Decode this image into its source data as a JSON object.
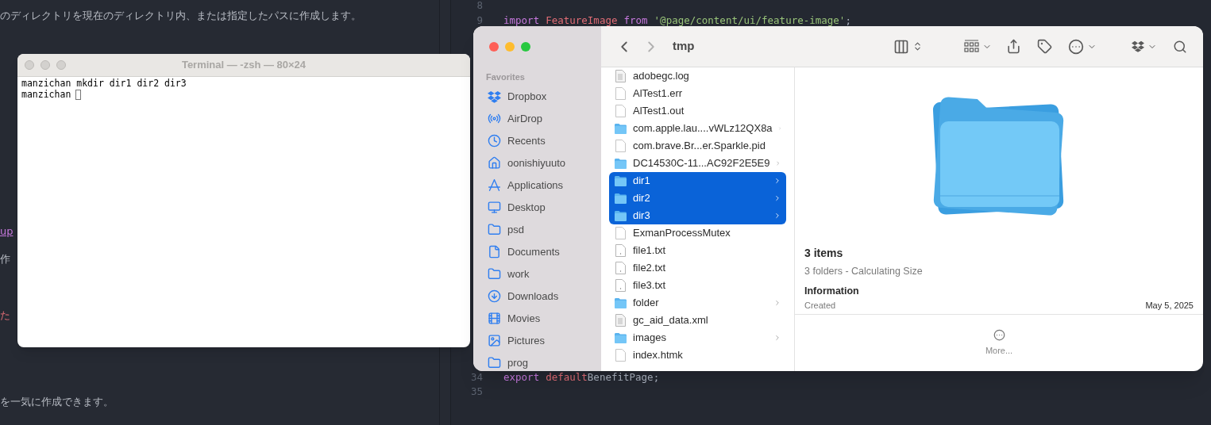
{
  "editor_left": {
    "lines": [
      {
        "text": "のディレクトリを現在のディレクトリ内、または指定したパスに作成します。",
        "kind": "text"
      },
      {
        "text": "up",
        "kind": "link"
      },
      {
        "text": "作",
        "kind": "text"
      },
      {
        "text": "た",
        "kind": "error"
      },
      {
        "text": "を一気に作成できます。",
        "kind": "text"
      }
    ]
  },
  "editor_right": {
    "lines": [
      {
        "number": "8"
      },
      {
        "number": "9",
        "tokens": [
          {
            "text": "import",
            "kind": "keyword"
          },
          {
            "text": "FeatureImage",
            "kind": "name"
          },
          {
            "text": "from",
            "kind": "keyword"
          },
          {
            "text": "'@page/content/ui/feature-image'",
            "kind": "string"
          },
          {
            "text": ";",
            "kind": "plain"
          }
        ]
      },
      {
        "number": "34",
        "tokens": [
          {
            "text": "export",
            "kind": "keyword"
          },
          {
            "text": "default",
            "kind": "name"
          },
          {
            "text": "BenefitPage;",
            "kind": "plain"
          }
        ]
      },
      {
        "number": "35"
      }
    ]
  },
  "terminal": {
    "title": "Terminal — -zsh — 80×24",
    "lines": [
      "manzichan mkdir dir1 dir2 dir3",
      "manzichan"
    ]
  },
  "finder": {
    "title": "tmp",
    "sidebar": {
      "heading": "Favorites",
      "items": [
        {
          "label": "Dropbox"
        },
        {
          "label": "AirDrop"
        },
        {
          "label": "Recents"
        },
        {
          "label": "oonishiyuuto"
        },
        {
          "label": "Applications"
        },
        {
          "label": "Desktop"
        },
        {
          "label": "psd"
        },
        {
          "label": "Documents"
        },
        {
          "label": "work"
        },
        {
          "label": "Downloads"
        },
        {
          "label": "Movies"
        },
        {
          "label": "Pictures"
        },
        {
          "label": "prog"
        }
      ]
    },
    "files": [
      {
        "name": "adobegc.log",
        "kind": "log",
        "selected": false
      },
      {
        "name": "AlTest1.err",
        "kind": "file",
        "selected": false
      },
      {
        "name": "AlTest1.out",
        "kind": "file",
        "selected": false
      },
      {
        "name": "com.apple.lau....vWLz12QX8a",
        "kind": "folder",
        "selected": false
      },
      {
        "name": "com.brave.Br...er.Sparkle.pid",
        "kind": "file",
        "selected": false
      },
      {
        "name": "DC14530C-11...AC92F2E5E9",
        "kind": "folder",
        "selected": false
      },
      {
        "name": "dir1",
        "kind": "folder",
        "selected": true
      },
      {
        "name": "dir2",
        "kind": "folder",
        "selected": true
      },
      {
        "name": "dir3",
        "kind": "folder",
        "selected": true
      },
      {
        "name": "ExmanProcessMutex",
        "kind": "file",
        "selected": false
      },
      {
        "name": "file1.txt",
        "kind": "text",
        "selected": false
      },
      {
        "name": "file2.txt",
        "kind": "text",
        "selected": false
      },
      {
        "name": "file3.txt",
        "kind": "text",
        "selected": false
      },
      {
        "name": "folder",
        "kind": "folder",
        "selected": false
      },
      {
        "name": "gc_aid_data.xml",
        "kind": "log",
        "selected": false
      },
      {
        "name": "images",
        "kind": "folder",
        "selected": false
      },
      {
        "name": "index.htmk",
        "kind": "file",
        "selected": false
      }
    ],
    "preview": {
      "title": "3 items",
      "subtitle": "3 folders - Calculating Size",
      "section": "Information",
      "created_label": "Created",
      "created_value": "May 5, 2025",
      "more": "More..."
    }
  }
}
